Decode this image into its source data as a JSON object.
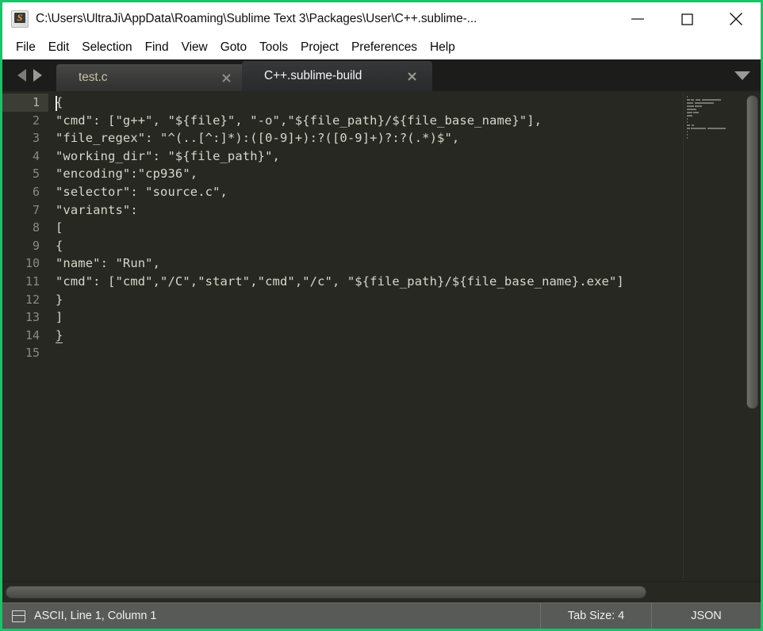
{
  "window": {
    "title": "C:\\Users\\UltraJi\\AppData\\Roaming\\Sublime Text 3\\Packages\\User\\C++.sublime-...",
    "app_icon": "sublime-text-icon",
    "border_color": "#17c46a",
    "controls": {
      "minimize": "minimize-icon",
      "maximize": "maximize-icon",
      "close": "close-icon"
    }
  },
  "menubar": {
    "items": [
      {
        "label": "File"
      },
      {
        "label": "Edit"
      },
      {
        "label": "Selection"
      },
      {
        "label": "Find"
      },
      {
        "label": "View"
      },
      {
        "label": "Goto"
      },
      {
        "label": "Tools"
      },
      {
        "label": "Project"
      },
      {
        "label": "Preferences"
      },
      {
        "label": "Help"
      }
    ]
  },
  "tabbar": {
    "nav_prev": "arrow-left-icon",
    "nav_next": "arrow-right-icon",
    "menu": "chevron-down-icon",
    "tabs": [
      {
        "label": "test.c",
        "active": false,
        "close": "close-icon"
      },
      {
        "label": "C++.sublime-build",
        "active": true,
        "close": "close-icon"
      }
    ]
  },
  "editor": {
    "active_line": 1,
    "cursor_line": 1,
    "cursor_column": 1,
    "bracket_match_line": 14,
    "line_numbers": [
      "1",
      "2",
      "3",
      "4",
      "5",
      "6",
      "7",
      "8",
      "9",
      "10",
      "11",
      "12",
      "13",
      "14",
      "15"
    ],
    "lines": [
      "{",
      "\"cmd\": [\"g++\", \"${file}\", \"-o\",\"${file_path}/${file_base_name}\"],",
      "\"file_regex\": \"^(..[^:]*):([0-9]+):?([0-9]+)?:?(.*)$\",",
      "\"working_dir\": \"${file_path}\",",
      "\"encoding\":\"cp936\",",
      "\"selector\": \"source.c\",",
      "\"variants\":",
      "[",
      "{",
      "\"name\": \"Run\",",
      "\"cmd\": [\"cmd\",\"/C\",\"start\",\"cmd\",\"/c\", \"${file_path}/${file_base_name}.exe\"]",
      "}",
      "]",
      "}",
      ""
    ],
    "colors": {
      "background": "#272822",
      "foreground": "#d6d6ca",
      "gutter_foreground": "#8a8a80",
      "active_line_gutter": "#3c3d35",
      "caret": "#f8f8f0"
    }
  },
  "statusbar": {
    "panel_icon": "panel-toggle-icon",
    "encoding_position": "ASCII, Line 1, Column 1",
    "tab_size": "Tab Size: 4",
    "syntax": "JSON"
  }
}
